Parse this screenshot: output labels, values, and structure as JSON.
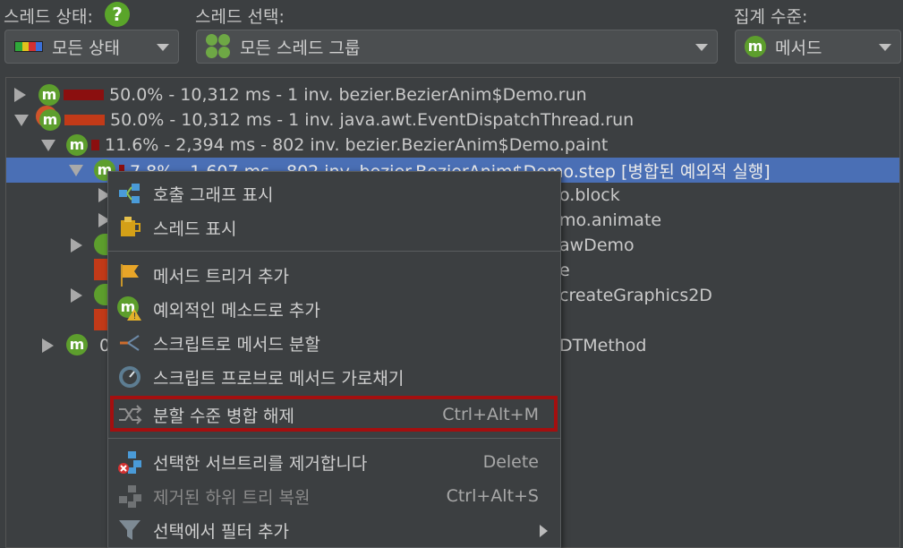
{
  "toolbar": {
    "thread_state_label": "스레드 상태:",
    "help_icon": "?",
    "thread_state_value": "모든 상태",
    "thread_select_label": "스레드 선택:",
    "thread_select_value": "모든 스레드 그룹",
    "aggregation_label": "집계 수준:",
    "aggregation_value": "메서드",
    "method_icon_letter": "m"
  },
  "tree": {
    "rows": [
      {
        "text": "50.0% - 10,312 ms - 1 inv. bezier.BezierAnim$Demo.run"
      },
      {
        "text": "50.0% - 10,312 ms - 1 inv. java.awt.EventDispatchThread.run"
      },
      {
        "text": "11.6% - 2,394 ms - 802 inv. bezier.BezierAnim$Demo.paint"
      },
      {
        "text": "7.8% - 1,607 ms - 802 inv. bezier.BezierAnim$Demo.step [병합된 예외적 실행]"
      }
    ],
    "peeks": [
      "o.block",
      "mo.animate",
      "awDemo",
      "e",
      "createGraphics2D",
      "0",
      "DTMethod"
    ]
  },
  "menu": {
    "items": [
      {
        "label": "호출 그래프 표시",
        "icon": "call-graph-icon"
      },
      {
        "label": "스레드 표시",
        "icon": "thread-icon"
      },
      {
        "label": "메서드 트리거 추가",
        "icon": "flag-icon"
      },
      {
        "label": "예외적인 메소드로 추가",
        "icon": "exceptional-method-icon"
      },
      {
        "label": "스크립트로 메서드 분할",
        "icon": "split-icon"
      },
      {
        "label": "스크립트 프로브로 메서드 가로채기",
        "icon": "probe-icon"
      },
      {
        "label": "분할 수준 병합 해제",
        "shortcut": "Ctrl+Alt+M",
        "icon": "unmerge-icon"
      },
      {
        "label": "선택한 서브트리를 제거합니다",
        "shortcut": "Delete",
        "icon": "remove-subtree-icon"
      },
      {
        "label": "제거된 하위 트리 복원",
        "shortcut": "Ctrl+Alt+S",
        "icon": "restore-subtree-icon"
      },
      {
        "label": "선택에서 필터 추가",
        "icon": "filter-icon"
      }
    ]
  },
  "colors": {
    "background": "#3c3f41",
    "selection": "#4a6fb5",
    "highlight_border": "#a40f0f",
    "method_icon": "#5d9e2d"
  }
}
